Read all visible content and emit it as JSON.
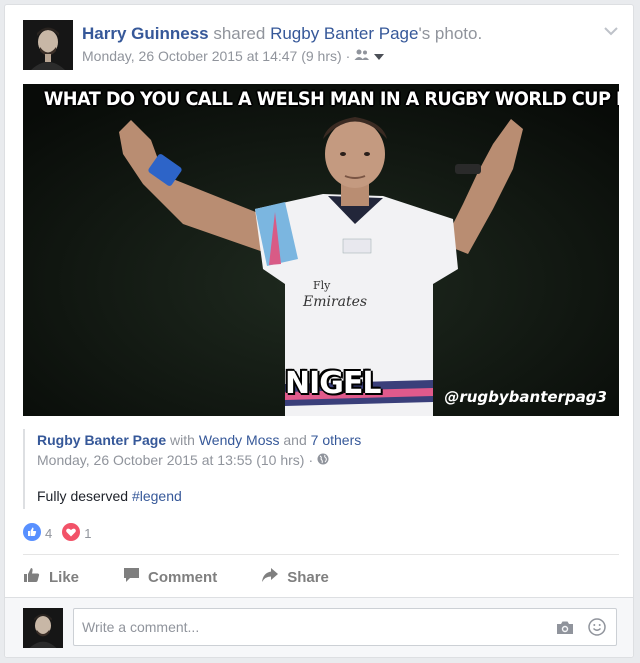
{
  "post": {
    "author": "Harry Guinness",
    "action": "shared",
    "shared_from": "Rugby Banter Page",
    "shared_suffix": "'s photo.",
    "timestamp": "Monday, 26 October 2015 at 14:47 (9 hrs)",
    "separator": "·",
    "audience_icon": "friends-icon"
  },
  "photo": {
    "top_text": "WHAT DO YOU CALL A WELSH MAN IN A RUGBY WORLD CUP FINAL?",
    "bottom_text": "NIGEL",
    "watermark": "@rugbybanterpag3",
    "shirt_text": "Fly Emirates"
  },
  "original": {
    "page": "Rugby Banter Page",
    "with_word": "with",
    "tagged": "Wendy Moss",
    "and_word": "and",
    "others": "7 others",
    "timestamp": "Monday, 26 October 2015 at 13:55 (10 hrs)",
    "separator": "·",
    "audience_icon": "globe-icon",
    "caption_text": "Fully deserved ",
    "hashtag": "#legend"
  },
  "reactions": {
    "like_count": "4",
    "love_count": "1",
    "like_color": "#5890ff",
    "love_color": "#f25268"
  },
  "actions": {
    "like": "Like",
    "comment": "Comment",
    "share": "Share"
  },
  "comment_box": {
    "placeholder": "Write a comment..."
  },
  "colors": {
    "link": "#365899",
    "muted": "#90949c"
  }
}
